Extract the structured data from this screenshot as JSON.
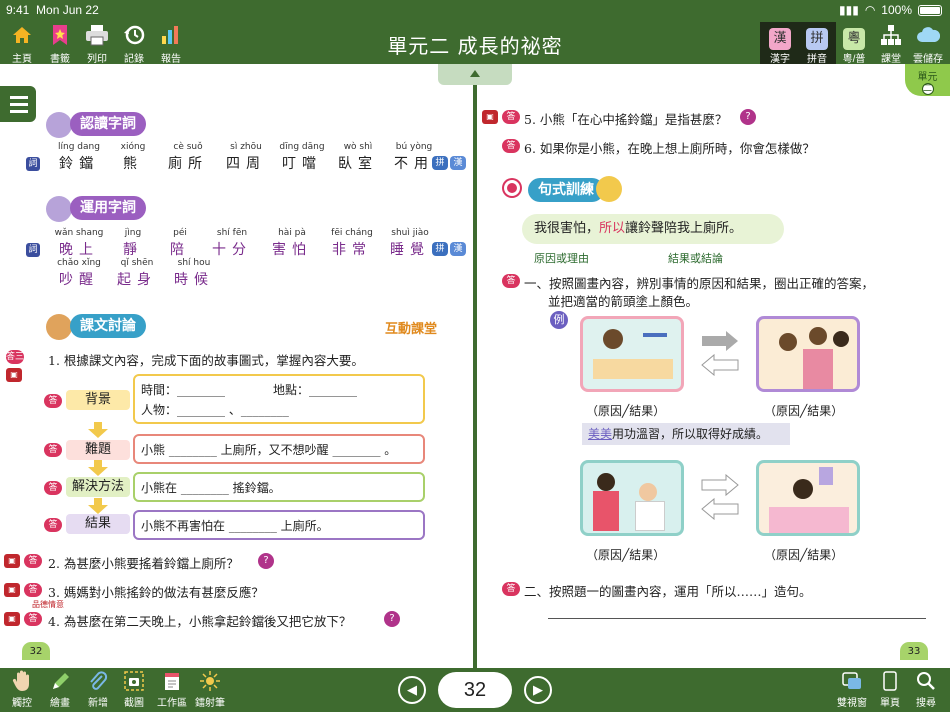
{
  "status": {
    "time": "9:41",
    "date": "Mon Jun 22",
    "battery": "100%"
  },
  "toolbar": {
    "left": [
      {
        "label": "主頁",
        "icon": "home-icon"
      },
      {
        "label": "書籤",
        "icon": "bookmark-icon"
      },
      {
        "label": "列印",
        "icon": "printer-icon"
      },
      {
        "label": "記錄",
        "icon": "history-icon"
      },
      {
        "label": "報告",
        "icon": "report-chart-icon"
      }
    ],
    "title": "單元二 成長的祕密",
    "right": [
      {
        "label": "漢字",
        "glyph": "漢"
      },
      {
        "label": "拼音",
        "glyph": "拼"
      },
      {
        "label": "粵/普",
        "glyph": "粵"
      },
      {
        "label": "課堂",
        "icon": "class-tree-icon"
      },
      {
        "label": "雲儲存",
        "icon": "cloud-icon"
      }
    ]
  },
  "unit_flag": {
    "line1": "單元",
    "line2": "二"
  },
  "left_page": {
    "number": "32",
    "section1": {
      "heading": "認讀字詞",
      "tag": "詞",
      "words": [
        {
          "py": "líng dang",
          "ch": "鈴鐺"
        },
        {
          "py": "xióng",
          "ch": "熊"
        },
        {
          "py": "cè suǒ",
          "ch": "廁所"
        },
        {
          "py": "sì zhōu",
          "ch": "四周"
        },
        {
          "py": "dīng dāng",
          "ch": "叮噹"
        },
        {
          "py": "wò shì",
          "ch": "臥室"
        },
        {
          "py": "bú yòng",
          "ch": "不用"
        }
      ],
      "right_tags": [
        "拼",
        "漢"
      ]
    },
    "section2": {
      "heading": "運用字詞",
      "tag": "詞",
      "words_row1": [
        {
          "py": "wǎn shang",
          "ch": "晚上"
        },
        {
          "py": "jìng",
          "ch": "靜"
        },
        {
          "py": "péi",
          "ch": "陪"
        },
        {
          "py": "shí fēn",
          "ch": "十分"
        },
        {
          "py": "hài pà",
          "ch": "害怕"
        },
        {
          "py": "fēi cháng",
          "ch": "非常"
        },
        {
          "py": "shuì jiào",
          "ch": "睡覺"
        }
      ],
      "words_row2": [
        {
          "py": "chǎo xǐng",
          "ch": "吵醒"
        },
        {
          "py": "qǐ shēn",
          "ch": "起身"
        },
        {
          "py": "shí hou",
          "ch": "時候"
        }
      ],
      "right_tags": [
        "拼",
        "漢"
      ]
    },
    "section3": {
      "heading": "課文討論",
      "logo_text": "互動課堂",
      "q1_text": "1. 根據課文內容，完成下面的故事圖式，掌握內容大要。",
      "q1_tag": "答三",
      "story": [
        {
          "label": "背景",
          "line1": "時間：________　　　　地點：________",
          "line2": "人物：________ 、________"
        },
        {
          "label": "難題",
          "line1": "小熊 ________ 上廁所，又不想吵醒 ________ 。"
        },
        {
          "label": "解決方法",
          "line1": "小熊在 ________ 搖鈴鐺。"
        },
        {
          "label": "結果",
          "line1": "小熊不再害怕在 ________ 上廁所。"
        }
      ],
      "q2": "2. 為甚麼小熊要搖着鈴鐺上廁所？",
      "q3": "3. 媽媽對小熊搖鈴的做法有甚麼反應？",
      "q4": "4. 為甚麼在第二天晚上，小熊拿起鈴鐺後又把它放下？",
      "q4_stamp": "品德情意",
      "answer_tag": "答",
      "bulb": "?"
    }
  },
  "right_page": {
    "number": "33",
    "q5": "5. 小熊「在心中搖鈴鐺」是指甚麼？",
    "q6": "6. 如果你是小熊，在晚上想上廁所時，你會怎樣做？",
    "section_heading": "句式訓練",
    "sentence": {
      "part1": "我很害怕，",
      "connector": "所以",
      "part2": "讓鈴聲陪我上廁所。",
      "cause_label": "原因或理由",
      "effect_label": "結果或結論"
    },
    "task1_line1": "一、按照圖畫內容，辨別事情的原因和結果，圈出正確的答案，",
    "task1_line2": "並把適當的箭頭塗上顏色。",
    "example_tag": "例",
    "choice_label": "（原因╱結果）",
    "example_sentence": {
      "name": "美美",
      "rest": "用功溫習，所以取得好成績。"
    },
    "task2": "二、按照題一的圖畫內容，運用「所以……」造句。"
  },
  "bottom": {
    "left": [
      {
        "label": "觸控",
        "icon": "hand-icon"
      },
      {
        "label": "繪畫",
        "icon": "pen-icon"
      },
      {
        "label": "新增",
        "icon": "paperclip-icon"
      },
      {
        "label": "截圖",
        "icon": "screenshot-icon"
      },
      {
        "label": "工作區",
        "icon": "workspace-icon"
      },
      {
        "label": "鐳射筆",
        "icon": "laser-pen-icon"
      }
    ],
    "page": "32",
    "right": [
      {
        "label": "雙視窗",
        "icon": "dual-window-icon"
      },
      {
        "label": "單頁",
        "icon": "single-page-icon"
      },
      {
        "label": "搜尋",
        "icon": "search-icon"
      }
    ]
  }
}
